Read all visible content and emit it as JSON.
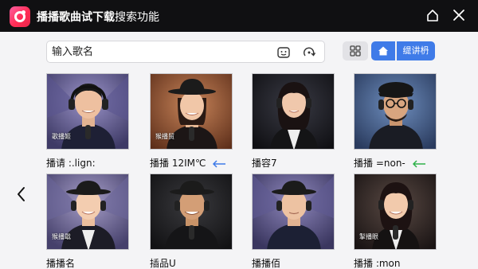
{
  "titlebar": {
    "title_bold": "播播歌曲试下载",
    "title_normal": "搜索功能"
  },
  "search": {
    "placeholder": "输入歌名"
  },
  "toolbar": {
    "tabs_label": "缇讲枬"
  },
  "cards": [
    {
      "thumb_label": "歌播姬",
      "caption": "播请 :.lign:",
      "link_color": ""
    },
    {
      "thumb_label": "猴播贸",
      "caption": "播播 12IM℃",
      "link_color": "#3f7be8"
    },
    {
      "thumb_label": "",
      "caption": "播容7",
      "link_color": ""
    },
    {
      "thumb_label": "",
      "caption": "播播 =non-",
      "link_color": "#2fb24a"
    },
    {
      "thumb_label": "猴播戢",
      "caption": "播播名",
      "link_color": ""
    },
    {
      "thumb_label": "",
      "caption": "插品U",
      "link_color": ""
    },
    {
      "thumb_label": "",
      "caption": "播播佰",
      "link_color": ""
    },
    {
      "thumb_label": "掣播眼",
      "caption": "播播 :mon",
      "link_color": ""
    }
  ],
  "colors": {
    "accent": "#3f7be8",
    "titlebar_bg": "#101012",
    "logo": "#ff2d55"
  }
}
